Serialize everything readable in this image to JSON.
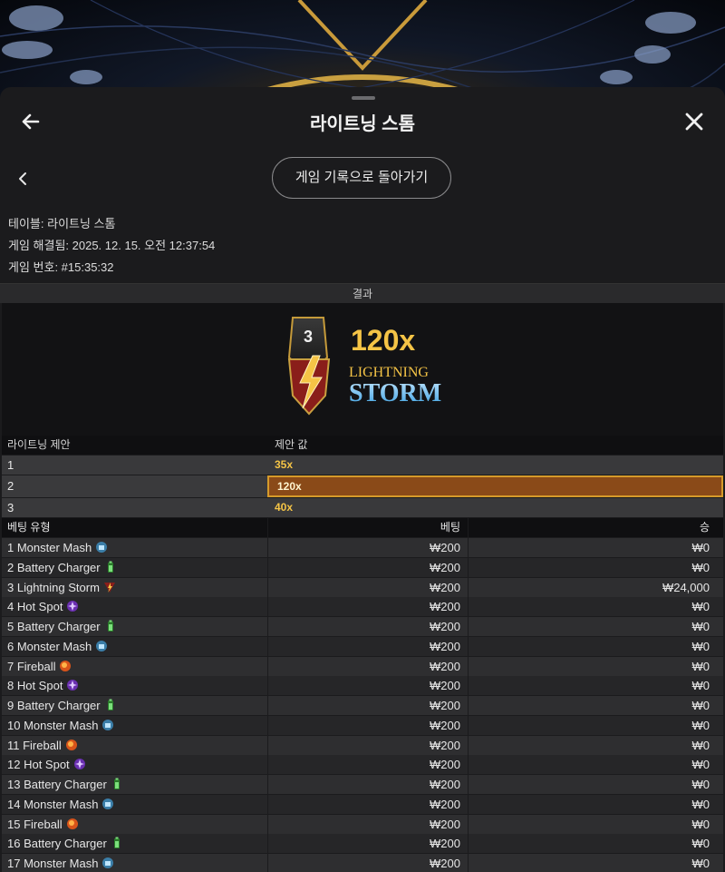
{
  "header": {
    "title": "라이트닝 스톰"
  },
  "subnav": {
    "back_to_history_label": "게임 기록으로 돌아가기"
  },
  "info": {
    "table": "테이블: 라이트닝 스톰",
    "resolved": "게임 해결됨: 2025. 12. 15. 오전 12:37:54",
    "game_number": "게임 번호: #15:35:32"
  },
  "result": {
    "section_label": "결과",
    "badge_number": "3",
    "multiplier": "120x",
    "logo_line1": "LIGHTNING",
    "logo_line2": "STORM"
  },
  "lightning_table": {
    "col1_header": "라이트닝 제안",
    "col2_header": "제안 값",
    "rows": [
      {
        "index": "1",
        "value": "35x"
      },
      {
        "index": "2",
        "value": "120x",
        "selected": true
      },
      {
        "index": "3",
        "value": "40x"
      }
    ]
  },
  "bets_table": {
    "col1_header": "베팅 유형",
    "col2_header": "베팅",
    "col3_header": "승",
    "rows": [
      {
        "type": "1 Monster Mash",
        "icon": "monster-mash-icon",
        "bet": "₩200",
        "win": "₩0"
      },
      {
        "type": "2 Battery Charger",
        "icon": "battery-charger-icon",
        "bet": "₩200",
        "win": "₩0"
      },
      {
        "type": "3 Lightning Storm",
        "icon": "lightning-storm-icon",
        "bet": "₩200",
        "win": "₩24,000"
      },
      {
        "type": "4 Hot Spot",
        "icon": "hot-spot-icon",
        "bet": "₩200",
        "win": "₩0"
      },
      {
        "type": "5 Battery Charger",
        "icon": "battery-charger-icon",
        "bet": "₩200",
        "win": "₩0"
      },
      {
        "type": "6 Monster Mash",
        "icon": "monster-mash-icon",
        "bet": "₩200",
        "win": "₩0"
      },
      {
        "type": "7 Fireball",
        "icon": "fireball-icon",
        "bet": "₩200",
        "win": "₩0"
      },
      {
        "type": "8 Hot Spot",
        "icon": "hot-spot-icon",
        "bet": "₩200",
        "win": "₩0"
      },
      {
        "type": "9 Battery Charger",
        "icon": "battery-charger-icon",
        "bet": "₩200",
        "win": "₩0"
      },
      {
        "type": "10 Monster Mash",
        "icon": "monster-mash-icon",
        "bet": "₩200",
        "win": "₩0"
      },
      {
        "type": "11 Fireball",
        "icon": "fireball-icon",
        "bet": "₩200",
        "win": "₩0"
      },
      {
        "type": "12 Hot Spot",
        "icon": "hot-spot-icon",
        "bet": "₩200",
        "win": "₩0"
      },
      {
        "type": "13 Battery Charger",
        "icon": "battery-charger-icon",
        "bet": "₩200",
        "win": "₩0"
      },
      {
        "type": "14 Monster Mash",
        "icon": "monster-mash-icon",
        "bet": "₩200",
        "win": "₩0"
      },
      {
        "type": "15 Fireball",
        "icon": "fireball-icon",
        "bet": "₩200",
        "win": "₩0"
      },
      {
        "type": "16 Battery Charger",
        "icon": "battery-charger-icon",
        "bet": "₩200",
        "win": "₩0"
      },
      {
        "type": "17 Monster Mash",
        "icon": "monster-mash-icon",
        "bet": "₩200",
        "win": "₩0"
      }
    ]
  },
  "colors": {
    "multiplier_gold": "#f5c446",
    "selected_row": "#8a4a18",
    "selected_border": "#d59a2a"
  }
}
